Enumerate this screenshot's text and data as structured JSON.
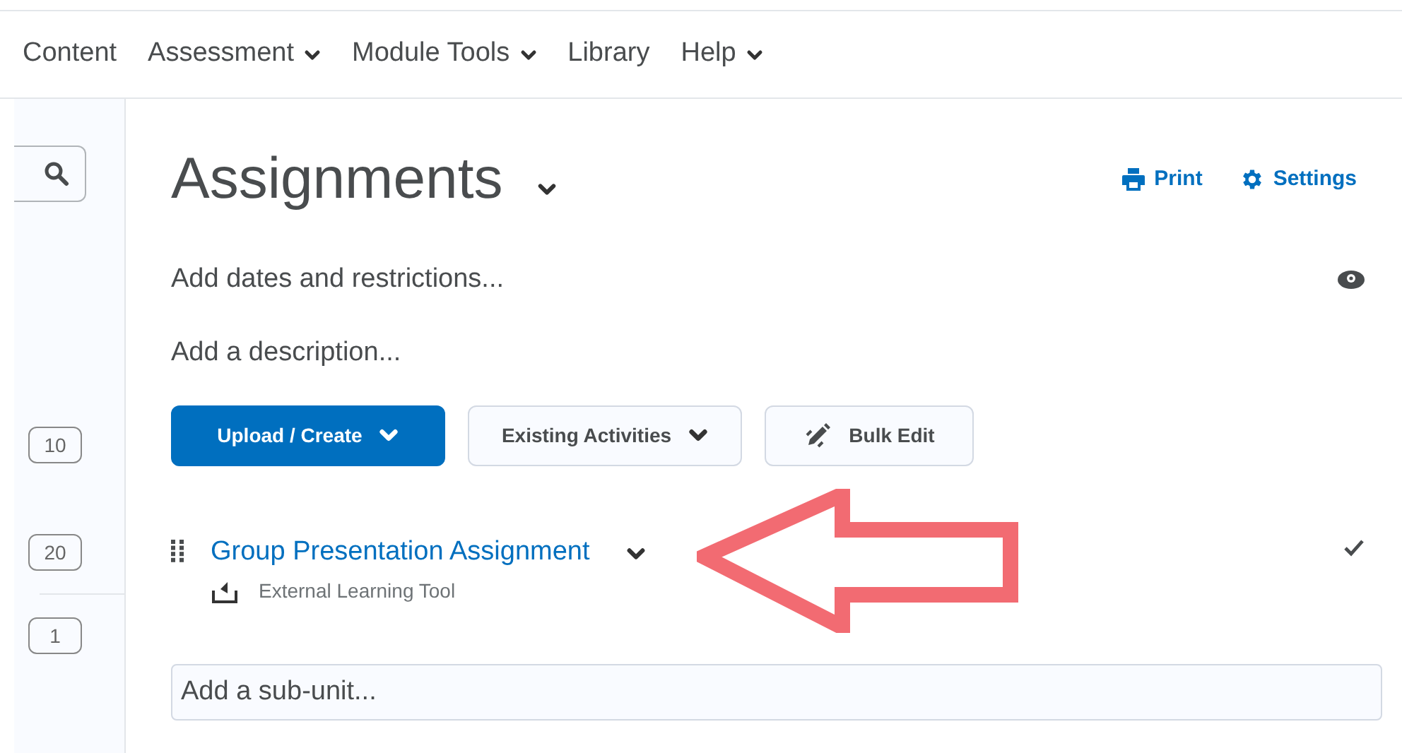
{
  "nav": [
    {
      "label": "Content",
      "has_menu": false
    },
    {
      "label": "Assessment",
      "has_menu": true
    },
    {
      "label": "Module Tools",
      "has_menu": true
    },
    {
      "label": "Library",
      "has_menu": false
    },
    {
      "label": "Help",
      "has_menu": true
    }
  ],
  "sidebar": {
    "counts": [
      "10",
      "20",
      "1"
    ]
  },
  "page": {
    "title": "Assignments",
    "actions": [
      {
        "label": "Print",
        "kind": "print"
      },
      {
        "label": "Settings",
        "kind": "settings"
      }
    ],
    "dates_link": "Add dates and restrictions...",
    "description_link": "Add a description...",
    "buttons": [
      {
        "label": "Upload / Create",
        "kind": "primary",
        "has_menu": true
      },
      {
        "label": "Existing Activities",
        "kind": "secondary",
        "has_menu": true
      },
      {
        "label": "Bulk Edit",
        "kind": "edit",
        "has_menu": false
      }
    ],
    "items": [
      {
        "title": "Group Presentation Assignment",
        "type": "External Learning Tool"
      }
    ],
    "sub_unit": {
      "placeholder": "Add a sub-unit..."
    }
  }
}
